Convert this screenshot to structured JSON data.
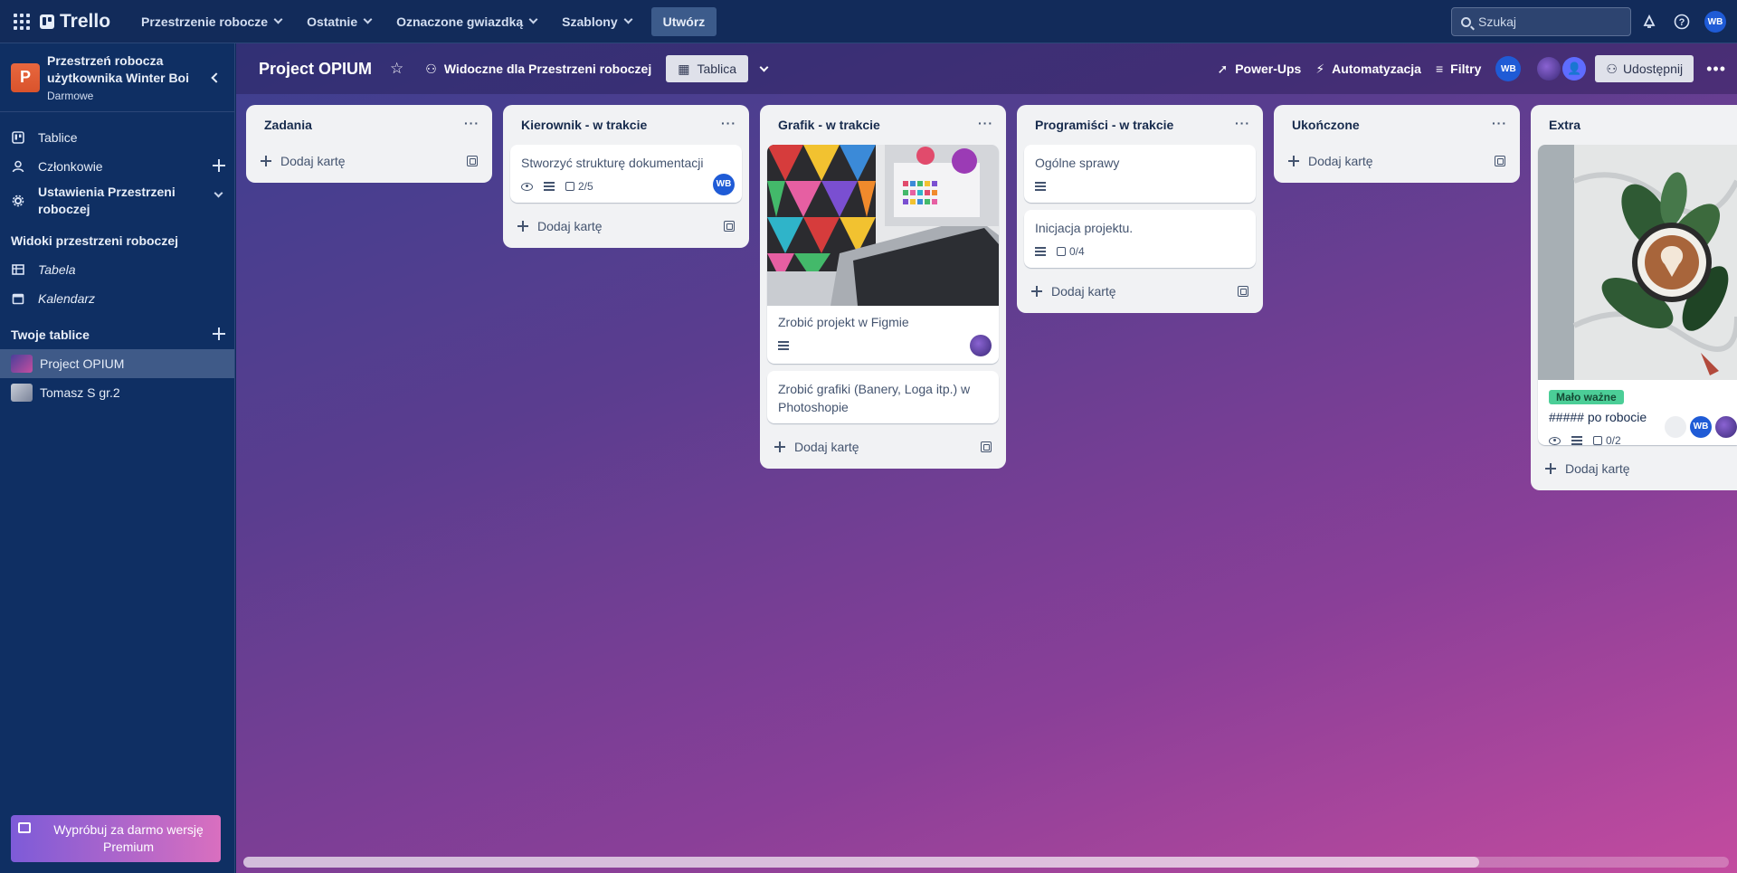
{
  "topbar": {
    "logo": "Trello",
    "nav": [
      {
        "label": "Przestrzenie robocze"
      },
      {
        "label": "Ostatnie"
      },
      {
        "label": "Oznaczone gwiazdką"
      },
      {
        "label": "Szablony"
      }
    ],
    "create_label": "Utwórz",
    "search_placeholder": "Szukaj",
    "user_initials": "WB"
  },
  "sidebar": {
    "workspace_initial": "P",
    "workspace_name": "Przestrzeń robocza użytkownika Winter Boi",
    "workspace_plan": "Darmowe",
    "items": [
      {
        "label": "Tablice",
        "icon": "board-icon"
      },
      {
        "label": "Członkowie",
        "icon": "person-icon"
      },
      {
        "label": "Ustawienia Przestrzeni roboczej",
        "icon": "gear-icon"
      }
    ],
    "views_title": "Widoki przestrzeni roboczej",
    "views": [
      {
        "label": "Tabela",
        "icon": "table-icon"
      },
      {
        "label": "Kalendarz",
        "icon": "calendar-icon"
      }
    ],
    "boards_title": "Twoje tablice",
    "boards": [
      {
        "label": "Project OPIUM",
        "active": true
      },
      {
        "label": "Tomasz S gr.2",
        "active": false
      }
    ],
    "premium_label": "Wypróbuj za darmo wersję Premium"
  },
  "board": {
    "title": "Project OPIUM",
    "visibility": "Widoczne dla Przestrzeni roboczej",
    "view_tab": "Tablica",
    "powerups": "Power-Ups",
    "automation": "Automatyzacja",
    "filters": "Filtry",
    "member_initials": "WB",
    "share": "Udostępnij",
    "add_card_label": "Dodaj kartę",
    "lists": [
      {
        "title": "Zadania",
        "cards": []
      },
      {
        "title": "Kierownik - w trakcie",
        "cards": [
          {
            "title": "Stworzyć strukturę dokumentacji",
            "checklist": "2/5",
            "member": "WB"
          }
        ]
      },
      {
        "title": "Grafik - w trakcie",
        "cards": [
          {
            "title": "Zrobić projekt w Figmie"
          },
          {
            "title": "Zrobić grafiki (Banery, Loga itp.) w Photoshopie"
          }
        ]
      },
      {
        "title": "Programiści - w trakcie",
        "cards": [
          {
            "title": "Ogólne sprawy"
          },
          {
            "title": "Inicjacja projektu.",
            "checklist": "0/4"
          }
        ]
      },
      {
        "title": "Ukończone",
        "cards": []
      },
      {
        "title": "Extra",
        "cards": [
          {
            "label": "Mało ważne",
            "title": "##### po robocie",
            "checklist": "0/2",
            "member": "WB"
          }
        ]
      }
    ]
  },
  "colors": {
    "topbar": "#122b5a",
    "sidebar": "#0f2f63",
    "accent": "#1f5bd6",
    "label_green": "#4bce97"
  }
}
